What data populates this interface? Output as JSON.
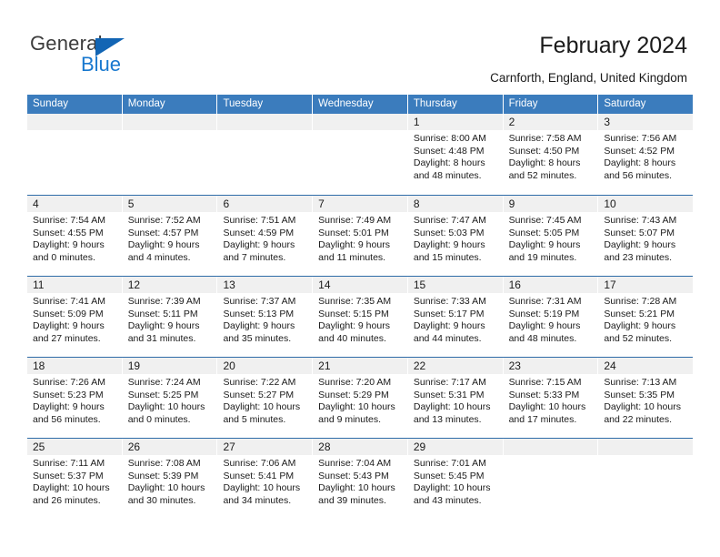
{
  "brand": {
    "name_part1": "General",
    "name_part2": "Blue",
    "triangle_color": "#1265b4",
    "blue_color": "#1878cf"
  },
  "header": {
    "title": "February 2024",
    "subtitle": "Carnforth, England, United Kingdom"
  },
  "theme": {
    "header_blue": "#3b7cbd",
    "row_divider_blue": "#2f6ca8",
    "daynum_band": "#f0f0f0"
  },
  "weekdays": [
    "Sunday",
    "Monday",
    "Tuesday",
    "Wednesday",
    "Thursday",
    "Friday",
    "Saturday"
  ],
  "weeks": [
    [
      {
        "day": "",
        "lines": []
      },
      {
        "day": "",
        "lines": []
      },
      {
        "day": "",
        "lines": []
      },
      {
        "day": "",
        "lines": []
      },
      {
        "day": "1",
        "lines": [
          "Sunrise: 8:00 AM",
          "Sunset: 4:48 PM",
          "Daylight: 8 hours",
          "and 48 minutes."
        ]
      },
      {
        "day": "2",
        "lines": [
          "Sunrise: 7:58 AM",
          "Sunset: 4:50 PM",
          "Daylight: 8 hours",
          "and 52 minutes."
        ]
      },
      {
        "day": "3",
        "lines": [
          "Sunrise: 7:56 AM",
          "Sunset: 4:52 PM",
          "Daylight: 8 hours",
          "and 56 minutes."
        ]
      }
    ],
    [
      {
        "day": "4",
        "lines": [
          "Sunrise: 7:54 AM",
          "Sunset: 4:55 PM",
          "Daylight: 9 hours",
          "and 0 minutes."
        ]
      },
      {
        "day": "5",
        "lines": [
          "Sunrise: 7:52 AM",
          "Sunset: 4:57 PM",
          "Daylight: 9 hours",
          "and 4 minutes."
        ]
      },
      {
        "day": "6",
        "lines": [
          "Sunrise: 7:51 AM",
          "Sunset: 4:59 PM",
          "Daylight: 9 hours",
          "and 7 minutes."
        ]
      },
      {
        "day": "7",
        "lines": [
          "Sunrise: 7:49 AM",
          "Sunset: 5:01 PM",
          "Daylight: 9 hours",
          "and 11 minutes."
        ]
      },
      {
        "day": "8",
        "lines": [
          "Sunrise: 7:47 AM",
          "Sunset: 5:03 PM",
          "Daylight: 9 hours",
          "and 15 minutes."
        ]
      },
      {
        "day": "9",
        "lines": [
          "Sunrise: 7:45 AM",
          "Sunset: 5:05 PM",
          "Daylight: 9 hours",
          "and 19 minutes."
        ]
      },
      {
        "day": "10",
        "lines": [
          "Sunrise: 7:43 AM",
          "Sunset: 5:07 PM",
          "Daylight: 9 hours",
          "and 23 minutes."
        ]
      }
    ],
    [
      {
        "day": "11",
        "lines": [
          "Sunrise: 7:41 AM",
          "Sunset: 5:09 PM",
          "Daylight: 9 hours",
          "and 27 minutes."
        ]
      },
      {
        "day": "12",
        "lines": [
          "Sunrise: 7:39 AM",
          "Sunset: 5:11 PM",
          "Daylight: 9 hours",
          "and 31 minutes."
        ]
      },
      {
        "day": "13",
        "lines": [
          "Sunrise: 7:37 AM",
          "Sunset: 5:13 PM",
          "Daylight: 9 hours",
          "and 35 minutes."
        ]
      },
      {
        "day": "14",
        "lines": [
          "Sunrise: 7:35 AM",
          "Sunset: 5:15 PM",
          "Daylight: 9 hours",
          "and 40 minutes."
        ]
      },
      {
        "day": "15",
        "lines": [
          "Sunrise: 7:33 AM",
          "Sunset: 5:17 PM",
          "Daylight: 9 hours",
          "and 44 minutes."
        ]
      },
      {
        "day": "16",
        "lines": [
          "Sunrise: 7:31 AM",
          "Sunset: 5:19 PM",
          "Daylight: 9 hours",
          "and 48 minutes."
        ]
      },
      {
        "day": "17",
        "lines": [
          "Sunrise: 7:28 AM",
          "Sunset: 5:21 PM",
          "Daylight: 9 hours",
          "and 52 minutes."
        ]
      }
    ],
    [
      {
        "day": "18",
        "lines": [
          "Sunrise: 7:26 AM",
          "Sunset: 5:23 PM",
          "Daylight: 9 hours",
          "and 56 minutes."
        ]
      },
      {
        "day": "19",
        "lines": [
          "Sunrise: 7:24 AM",
          "Sunset: 5:25 PM",
          "Daylight: 10 hours",
          "and 0 minutes."
        ]
      },
      {
        "day": "20",
        "lines": [
          "Sunrise: 7:22 AM",
          "Sunset: 5:27 PM",
          "Daylight: 10 hours",
          "and 5 minutes."
        ]
      },
      {
        "day": "21",
        "lines": [
          "Sunrise: 7:20 AM",
          "Sunset: 5:29 PM",
          "Daylight: 10 hours",
          "and 9 minutes."
        ]
      },
      {
        "day": "22",
        "lines": [
          "Sunrise: 7:17 AM",
          "Sunset: 5:31 PM",
          "Daylight: 10 hours",
          "and 13 minutes."
        ]
      },
      {
        "day": "23",
        "lines": [
          "Sunrise: 7:15 AM",
          "Sunset: 5:33 PM",
          "Daylight: 10 hours",
          "and 17 minutes."
        ]
      },
      {
        "day": "24",
        "lines": [
          "Sunrise: 7:13 AM",
          "Sunset: 5:35 PM",
          "Daylight: 10 hours",
          "and 22 minutes."
        ]
      }
    ],
    [
      {
        "day": "25",
        "lines": [
          "Sunrise: 7:11 AM",
          "Sunset: 5:37 PM",
          "Daylight: 10 hours",
          "and 26 minutes."
        ]
      },
      {
        "day": "26",
        "lines": [
          "Sunrise: 7:08 AM",
          "Sunset: 5:39 PM",
          "Daylight: 10 hours",
          "and 30 minutes."
        ]
      },
      {
        "day": "27",
        "lines": [
          "Sunrise: 7:06 AM",
          "Sunset: 5:41 PM",
          "Daylight: 10 hours",
          "and 34 minutes."
        ]
      },
      {
        "day": "28",
        "lines": [
          "Sunrise: 7:04 AM",
          "Sunset: 5:43 PM",
          "Daylight: 10 hours",
          "and 39 minutes."
        ]
      },
      {
        "day": "29",
        "lines": [
          "Sunrise: 7:01 AM",
          "Sunset: 5:45 PM",
          "Daylight: 10 hours",
          "and 43 minutes."
        ]
      },
      {
        "day": "",
        "lines": []
      },
      {
        "day": "",
        "lines": []
      }
    ]
  ]
}
